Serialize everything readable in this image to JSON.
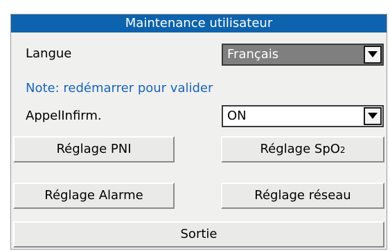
{
  "dialog": {
    "title": "Maintenance utilisateur",
    "language": {
      "label": "Langue",
      "value": "Français",
      "icon": "chevron-down-icon"
    },
    "note": "Note: redémarrer pour valider",
    "nurse_call": {
      "label": "AppelInfirm.",
      "value": "ON",
      "icon": "chevron-down-icon"
    },
    "buttons": {
      "nibp": "Réglage PNI",
      "spo2_prefix": "Réglage SpO",
      "spo2_subscript": "2",
      "alarm": "Réglage Alarme",
      "network": "Réglage réseau",
      "exit": "Sortie"
    }
  },
  "colors": {
    "title_bar": "#0d63ad",
    "note_text": "#1565c0",
    "dialog_bg": "#f0f0ee",
    "disabled_select": "#7f7f7f"
  }
}
